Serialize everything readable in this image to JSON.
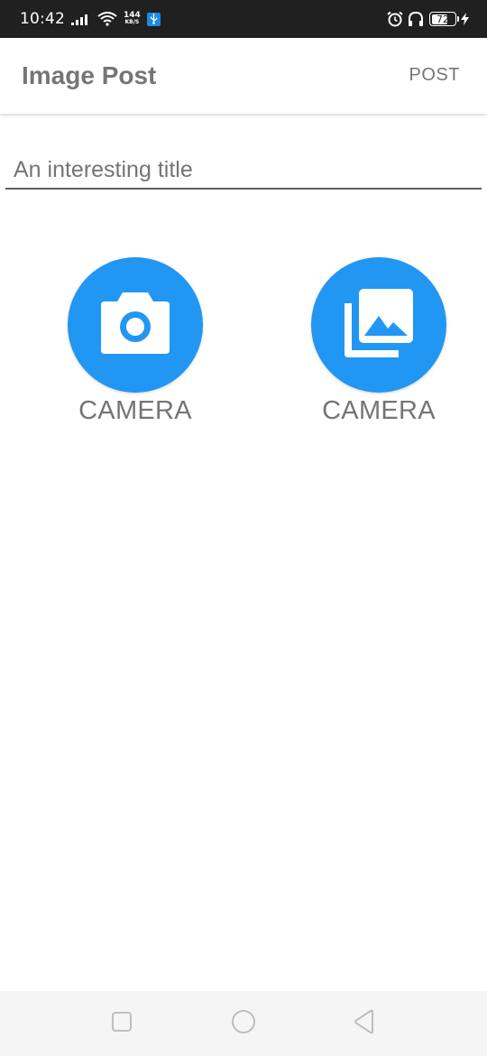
{
  "status_bar": {
    "time": "10:42",
    "net_speed_value": "144",
    "net_speed_unit": "KB/S",
    "battery_level": "72",
    "icons": [
      "signal-icon",
      "wifi-icon",
      "usb-icon",
      "alarm-icon",
      "headphones-icon",
      "battery-icon",
      "charging-icon"
    ]
  },
  "app_bar": {
    "title": "Image Post",
    "post_label": "POST"
  },
  "title_input": {
    "placeholder": "An interesting title",
    "value": ""
  },
  "pickers": [
    {
      "icon": "camera-icon",
      "label": "CAMERA"
    },
    {
      "icon": "photo-library-icon",
      "label": "CAMERA"
    }
  ],
  "nav_bar": {
    "icons": [
      "recents-icon",
      "home-icon",
      "back-icon"
    ]
  },
  "colors": {
    "accent": "#2196f3",
    "status_bar": "#202020",
    "text_gray": "#757575",
    "nav_bar": "#f5f5f5"
  }
}
